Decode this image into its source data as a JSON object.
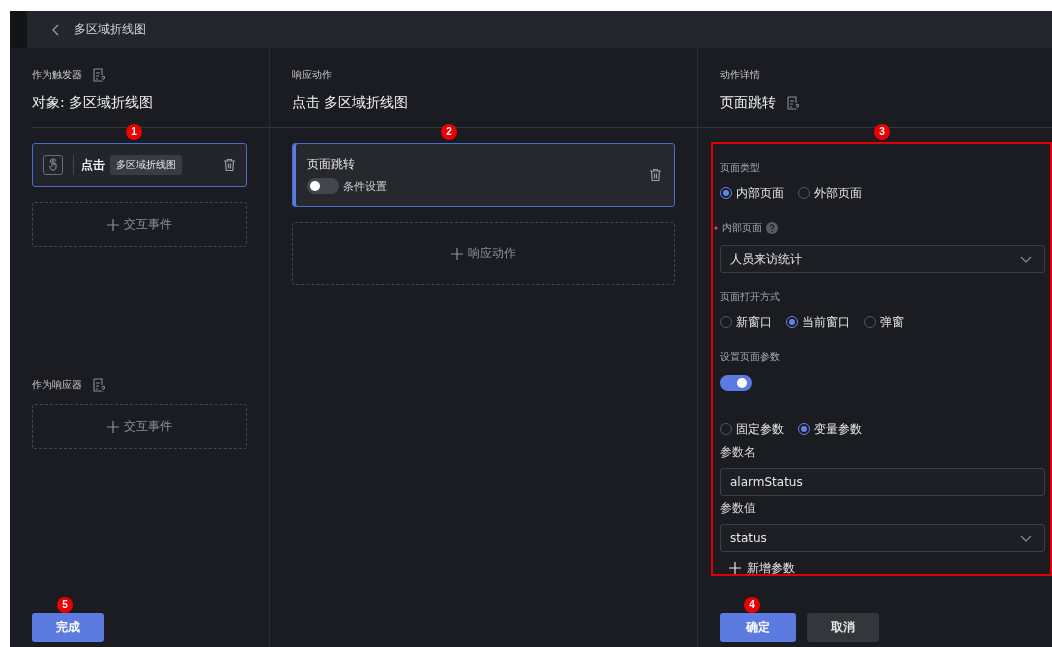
{
  "topbar": {
    "title": "多区域折线图"
  },
  "trigger_panel": {
    "label": "作为触发器",
    "title": "对象: 多区域折线图",
    "marker": "1",
    "events": [
      {
        "action": "点击",
        "target": "多区域折线图",
        "selected": true
      }
    ],
    "add_label": "交互事件"
  },
  "responder_panel": {
    "label": "作为响应器",
    "add_label": "交互事件"
  },
  "done_button": {
    "label": "完成",
    "marker": "5"
  },
  "actions_panel": {
    "label": "响应动作",
    "title": "点击 多区域折线图",
    "marker": "2",
    "actions": [
      {
        "title": "页面跳转",
        "condition_label": "条件设置",
        "condition_on": false,
        "selected": true
      }
    ],
    "add_label": "响应动作"
  },
  "details_panel": {
    "label": "动作详情",
    "title": "页面跳转",
    "marker": "3",
    "fields": [
      {
        "kind": "radio",
        "label": "页面类型",
        "options": [
          {
            "label": "内部页面",
            "selected": true
          },
          {
            "label": "外部页面",
            "selected": false
          }
        ]
      },
      {
        "kind": "select",
        "label": "内部页面",
        "required": true,
        "help": true,
        "value": "人员来访统计"
      },
      {
        "kind": "radio",
        "label": "页面打开方式",
        "options": [
          {
            "label": "新窗口",
            "selected": false
          },
          {
            "label": "当前窗口",
            "selected": true
          },
          {
            "label": "弹窗",
            "selected": false
          }
        ]
      },
      {
        "kind": "toggle",
        "label": "设置页面参数",
        "on": true
      },
      {
        "kind": "radio",
        "options": [
          {
            "label": "固定参数",
            "selected": false
          },
          {
            "label": "变量参数",
            "selected": true
          }
        ]
      },
      {
        "kind": "input",
        "label": "参数名",
        "label_strong": true,
        "value": "alarmStatus"
      },
      {
        "kind": "select",
        "label": "参数值",
        "label_strong": true,
        "value": "status"
      },
      {
        "kind": "add",
        "label": "新增参数"
      }
    ],
    "buttons": [
      {
        "label": "确定",
        "kind": "primary",
        "marker": "4"
      },
      {
        "label": "取消",
        "kind": "secondary"
      }
    ]
  }
}
